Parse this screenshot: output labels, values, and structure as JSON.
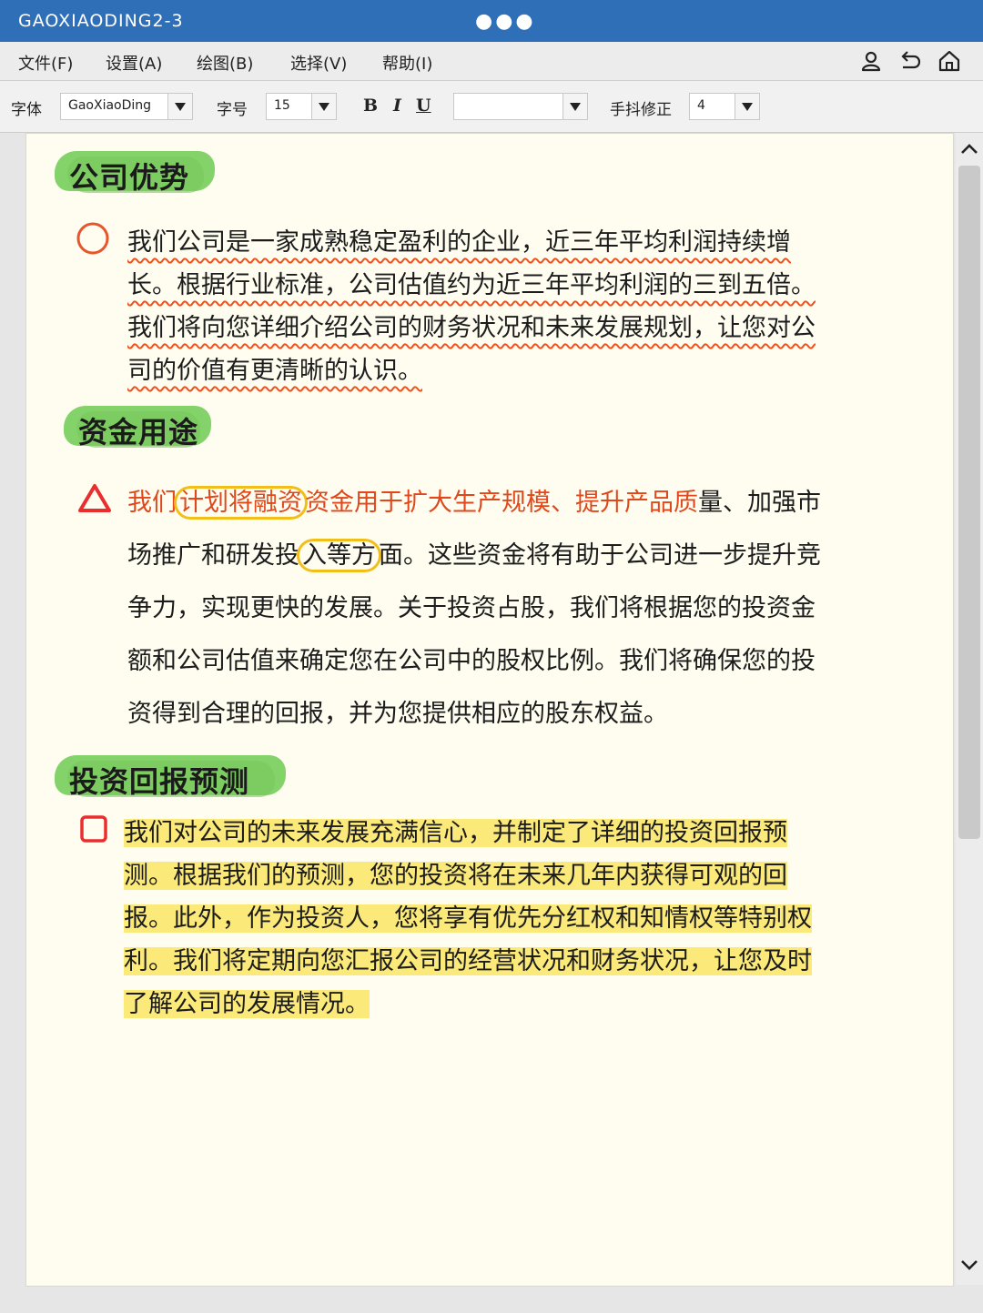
{
  "window": {
    "title": "GAOXIAODING2-3",
    "dots": "●●●"
  },
  "menu": {
    "items": [
      "文件(F)",
      "设置(A)",
      "绘图(B)",
      "选择(V)",
      "帮助(I)"
    ],
    "icons": [
      "user-icon",
      "undo-icon",
      "home-icon"
    ]
  },
  "toolbar": {
    "font_label": "字体",
    "font_value": "GaoXiaoDing",
    "size_label": "字号",
    "size_value": "15",
    "bold": "B",
    "italic": "I",
    "underline": "U",
    "color_value": "",
    "jitter_label": "手抖修正",
    "jitter_value": "4"
  },
  "sections": [
    {
      "heading": "公司优势",
      "marker": "circle",
      "lines": [
        "我们公司是一家成熟稳定盈利的企业，近三年平均利润持续增",
        "长。根据行业标准，公司估值约为近三年平均利润的三到五倍。",
        "我们将向您详细介绍公司的财务状况和未来发展规划，让您对公",
        "司的价值有更清晰的认识。"
      ]
    },
    {
      "heading": "资金用途",
      "marker": "triangle",
      "line1": {
        "a": "我们",
        "b": "计划将融资",
        "c": "资金用于扩大生产规模、提升产品质",
        "d": "量、加强市"
      },
      "line2": {
        "a": "场推广和研发投",
        "b": "入等方",
        "c": "面。这些资金将有助于公司进一步提升竞"
      },
      "lines_rest": [
        "争力，实现更快的发展。关于投资占股，我们将根据您的投资金",
        "额和公司估值来确定您在公司中的股权比例。我们将确保您的投",
        "资得到合理的回报，并为您提供相应的股东权益。"
      ]
    },
    {
      "heading": "投资回报预测",
      "marker": "square",
      "lines": [
        "我们对公司的未来发展充满信心，并制定了详细的投资回报预",
        "测。根据我们的预测，您的投资将在未来几年内获得可观的回",
        "报。此外，作为投资人，您将享有优先分红权和知情权等特别权",
        "利。我们将定期向您汇报公司的经营状况和财务状况，让您及时",
        "了解公司的发展情况。"
      ]
    }
  ],
  "colors": {
    "titlebar": "#2f6fb8",
    "heading_green": "#84d36a",
    "accent_red": "#e0481c",
    "circle_yellow": "#f2bf1a",
    "highlight_yellow": "#fbe97a"
  }
}
